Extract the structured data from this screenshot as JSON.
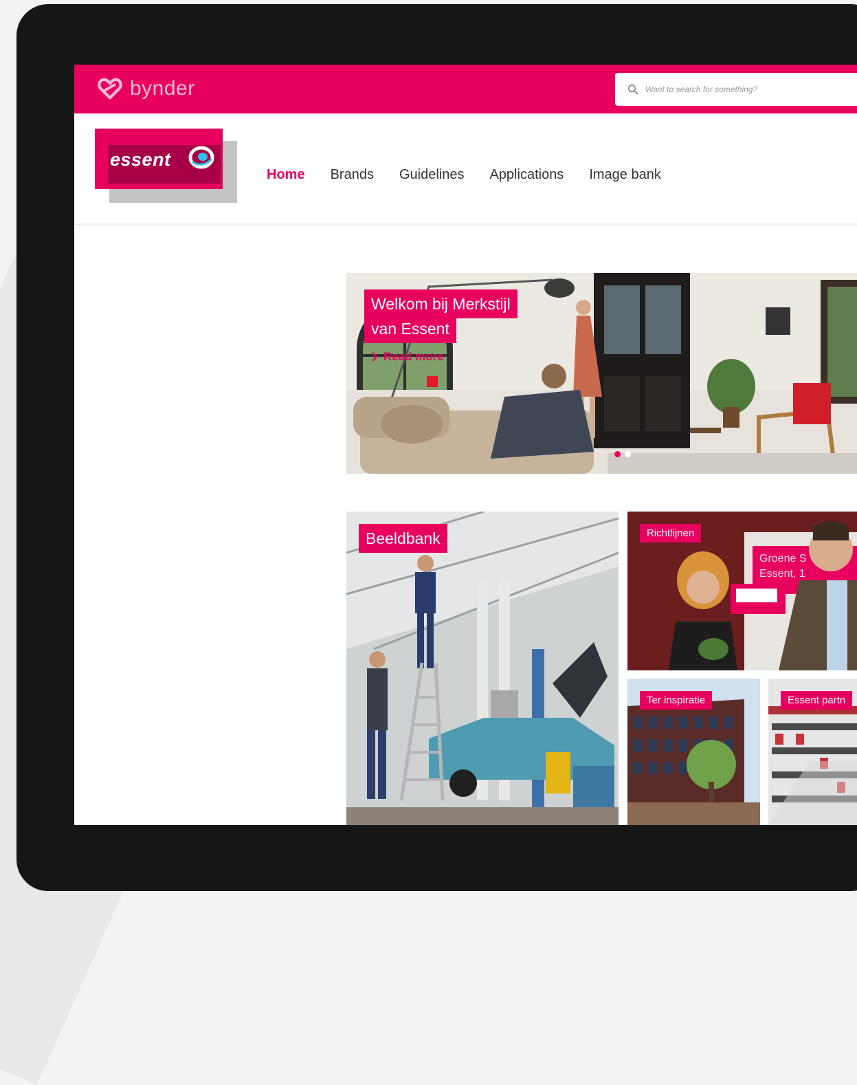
{
  "app": {
    "brand_name": "bynder",
    "search_placeholder": "Want to search for something?"
  },
  "header": {
    "logo_text": "essent",
    "nav": [
      {
        "label": "Home",
        "active": true
      },
      {
        "label": "Brands",
        "active": false
      },
      {
        "label": "Guidelines",
        "active": false
      },
      {
        "label": "Applications",
        "active": false
      },
      {
        "label": "Image bank",
        "active": false
      }
    ]
  },
  "hero": {
    "title_line1": "Welkom bij Merkstijl",
    "title_line2": "van Essent",
    "read_more": "Read more",
    "slides": 2,
    "active_slide": 1
  },
  "tiles": {
    "beeldbank": "Beeldbank",
    "richtlijnen": "Richtlijnen",
    "richtlijnen_sign_line1": "Groene S",
    "richtlijnen_sign_line2": "Essent, 1",
    "inspiratie": "Ter inspiratie",
    "partners": "Essent partn"
  },
  "colors": {
    "brand": "#e8005f",
    "brand_dark": "#a80047",
    "tablet": "#161616"
  }
}
